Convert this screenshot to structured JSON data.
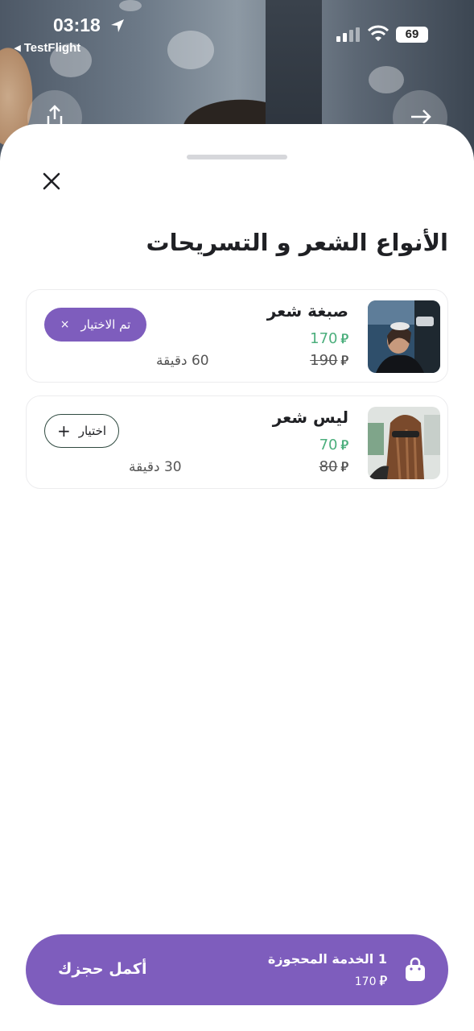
{
  "status_bar": {
    "time": "03:18",
    "back_app": "◂ TestFlight",
    "battery": "69"
  },
  "sheet": {
    "title": "الأنواع الشعر و التسريحات",
    "close_icon": "close-icon"
  },
  "currency_symbol": "⃁",
  "services": [
    {
      "name": "صبغة شعر",
      "price": "170",
      "old_price": "190",
      "duration": "60 دقيقة",
      "selected": true,
      "chip_label": "تم الاختيار",
      "chip_icon": "×"
    },
    {
      "name": "ليس شعر",
      "price": "70",
      "old_price": "80",
      "duration": "30 دقيقة",
      "selected": false,
      "chip_label": "اختيار",
      "chip_icon": "+"
    }
  ],
  "cta": {
    "count_label": "1 الخدمة المحجوزة",
    "total": "170",
    "action_label": "أكمل حجزك"
  },
  "colors": {
    "accent": "#7e5dbd",
    "price_green": "#4caf7d",
    "text_dark": "#1f2024"
  }
}
